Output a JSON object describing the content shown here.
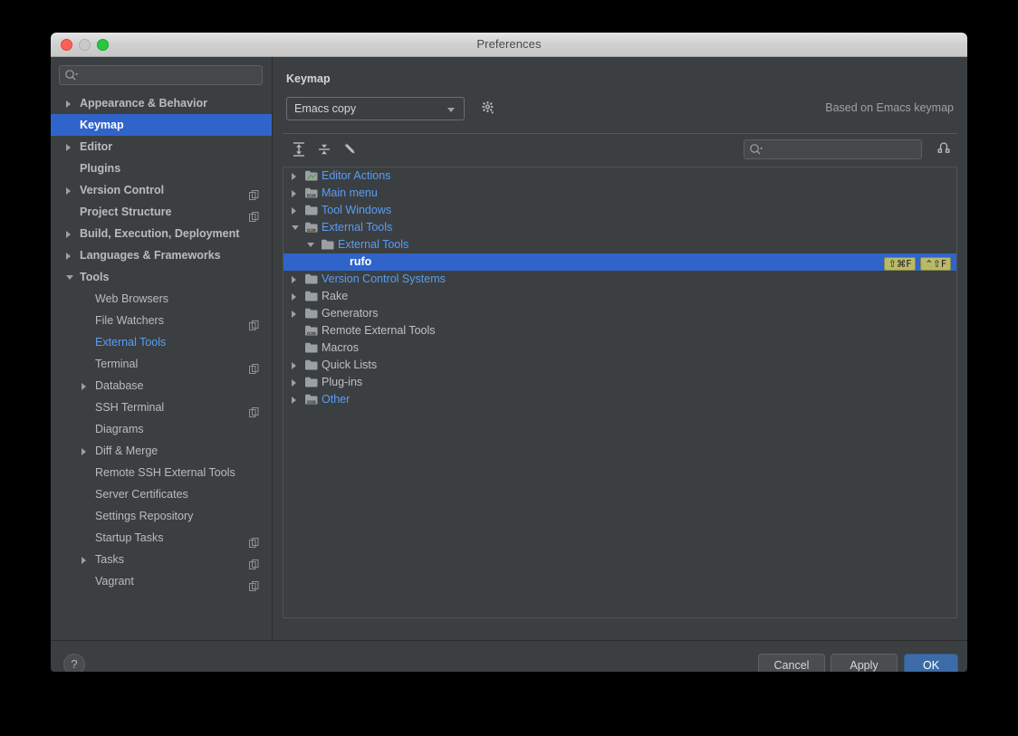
{
  "window": {
    "title": "Preferences",
    "traffic_lights": [
      "close",
      "minimize",
      "zoom"
    ]
  },
  "sidebar": {
    "search": {
      "value": "",
      "placeholder": ""
    },
    "items": [
      {
        "label": "Appearance & Behavior",
        "level": 0,
        "arrow": "right",
        "bold": true
      },
      {
        "label": "Keymap",
        "level": 0,
        "arrow": "none",
        "bold": true,
        "selected": true
      },
      {
        "label": "Editor",
        "level": 0,
        "arrow": "right",
        "bold": true
      },
      {
        "label": "Plugins",
        "level": 0,
        "arrow": "none",
        "bold": true
      },
      {
        "label": "Version Control",
        "level": 0,
        "arrow": "right",
        "bold": true,
        "copy_icon": true
      },
      {
        "label": "Project Structure",
        "level": 0,
        "arrow": "none",
        "bold": true,
        "copy_icon": true
      },
      {
        "label": "Build, Execution, Deployment",
        "level": 0,
        "arrow": "right",
        "bold": true
      },
      {
        "label": "Languages & Frameworks",
        "level": 0,
        "arrow": "right",
        "bold": true
      },
      {
        "label": "Tools",
        "level": 0,
        "arrow": "down",
        "bold": true
      },
      {
        "label": "Web Browsers",
        "level": 1,
        "arrow": "none"
      },
      {
        "label": "File Watchers",
        "level": 1,
        "arrow": "none",
        "copy_icon": true
      },
      {
        "label": "External Tools",
        "level": 1,
        "arrow": "none",
        "accent": true
      },
      {
        "label": "Terminal",
        "level": 1,
        "arrow": "none",
        "copy_icon": true
      },
      {
        "label": "Database",
        "level": 1,
        "arrow": "right"
      },
      {
        "label": "SSH Terminal",
        "level": 1,
        "arrow": "none",
        "copy_icon": true
      },
      {
        "label": "Diagrams",
        "level": 1,
        "arrow": "none"
      },
      {
        "label": "Diff & Merge",
        "level": 1,
        "arrow": "right"
      },
      {
        "label": "Remote SSH External Tools",
        "level": 1,
        "arrow": "none"
      },
      {
        "label": "Server Certificates",
        "level": 1,
        "arrow": "none"
      },
      {
        "label": "Settings Repository",
        "level": 1,
        "arrow": "none"
      },
      {
        "label": "Startup Tasks",
        "level": 1,
        "arrow": "none",
        "copy_icon": true
      },
      {
        "label": "Tasks",
        "level": 1,
        "arrow": "right",
        "copy_icon": true
      },
      {
        "label": "Vagrant",
        "level": 1,
        "arrow": "none",
        "copy_icon": true
      }
    ]
  },
  "main": {
    "title": "Keymap",
    "keymap_select": {
      "value": "Emacs copy"
    },
    "gear_icon": "gear-icon",
    "based_on": "Based on Emacs keymap",
    "toolbar": {
      "expand_all_icon": "expand-all-icon",
      "collapse_all_icon": "collapse-all-icon",
      "edit_shortcut_icon": "pencil-edit-icon",
      "search_value": "",
      "search_placeholder": "",
      "filter_by_shortcut_icon": "find-by-shortcut-icon"
    },
    "tree": [
      {
        "label": "Editor Actions",
        "depth": 0,
        "arrow": "right",
        "icon": "folder-editor-icon",
        "accent": true
      },
      {
        "label": "Main menu",
        "depth": 0,
        "arrow": "right",
        "icon": "folder-menu-icon",
        "accent": true
      },
      {
        "label": "Tool Windows",
        "depth": 0,
        "arrow": "right",
        "icon": "folder-icon",
        "accent": true
      },
      {
        "label": "External Tools",
        "depth": 0,
        "arrow": "down",
        "icon": "folder-tools-icon",
        "accent": true
      },
      {
        "label": "External Tools",
        "depth": 1,
        "arrow": "down",
        "icon": "folder-icon",
        "accent": true
      },
      {
        "label": "rufo",
        "depth": 2,
        "arrow": "none",
        "icon": "none",
        "selected": true,
        "shortcuts": [
          "⇧⌘F",
          "⌃⇧F"
        ]
      },
      {
        "label": "Version Control Systems",
        "depth": 0,
        "arrow": "right",
        "icon": "folder-icon",
        "accent": true
      },
      {
        "label": "Rake",
        "depth": 0,
        "arrow": "right",
        "icon": "folder-icon"
      },
      {
        "label": "Generators",
        "depth": 0,
        "arrow": "right",
        "icon": "folder-icon"
      },
      {
        "label": "Remote External Tools",
        "depth": 0,
        "arrow": "none",
        "icon": "folder-tools-icon"
      },
      {
        "label": "Macros",
        "depth": 0,
        "arrow": "none",
        "icon": "folder-icon"
      },
      {
        "label": "Quick Lists",
        "depth": 0,
        "arrow": "right",
        "icon": "folder-icon"
      },
      {
        "label": "Plug-ins",
        "depth": 0,
        "arrow": "right",
        "icon": "folder-icon"
      },
      {
        "label": "Other",
        "depth": 0,
        "arrow": "right",
        "icon": "folder-other-icon",
        "accent": true
      }
    ]
  },
  "footer": {
    "help_label": "?",
    "cancel_label": "Cancel",
    "apply_label": "Apply",
    "ok_label": "OK"
  },
  "colors": {
    "accent_blue": "#589df6",
    "selection_blue": "#2f65ca",
    "ok_button_blue": "#3c6ca8",
    "shortcut_badge": "#b9b96a",
    "panel_bg": "#3c3f41"
  }
}
